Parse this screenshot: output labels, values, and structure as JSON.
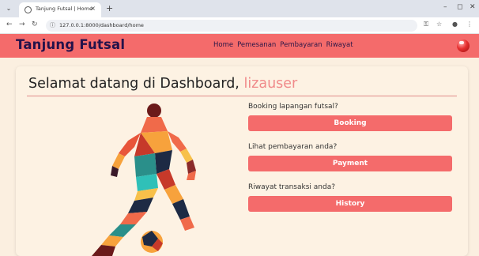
{
  "browser": {
    "tab_title": "Tanjung Futsal | Home",
    "tab_close": "×",
    "new_tab": "+",
    "url": "127.0.0.1:8000/dashboard/home",
    "minimize": "–",
    "maximize": "◻",
    "close": "✕"
  },
  "navbar": {
    "brand": "Tanjung Futsal",
    "links": [
      "Home",
      "Pemesanan",
      "Pembayaran",
      "Riwayat"
    ]
  },
  "main": {
    "welcome_prefix": "Selamat datang di Dashboard, ",
    "username": "lizauser",
    "actions": [
      {
        "prompt": "Booking lapangan futsal?",
        "button": "Booking"
      },
      {
        "prompt": "Lihat pembayaran anda?",
        "button": "Payment"
      },
      {
        "prompt": "Riwayat transaksi anda?",
        "button": "History"
      }
    ]
  },
  "colors": {
    "accent": "#f46b6b",
    "brand_text": "#24124a",
    "page_bg": "#fbefe0",
    "username": "#f08a8a"
  }
}
